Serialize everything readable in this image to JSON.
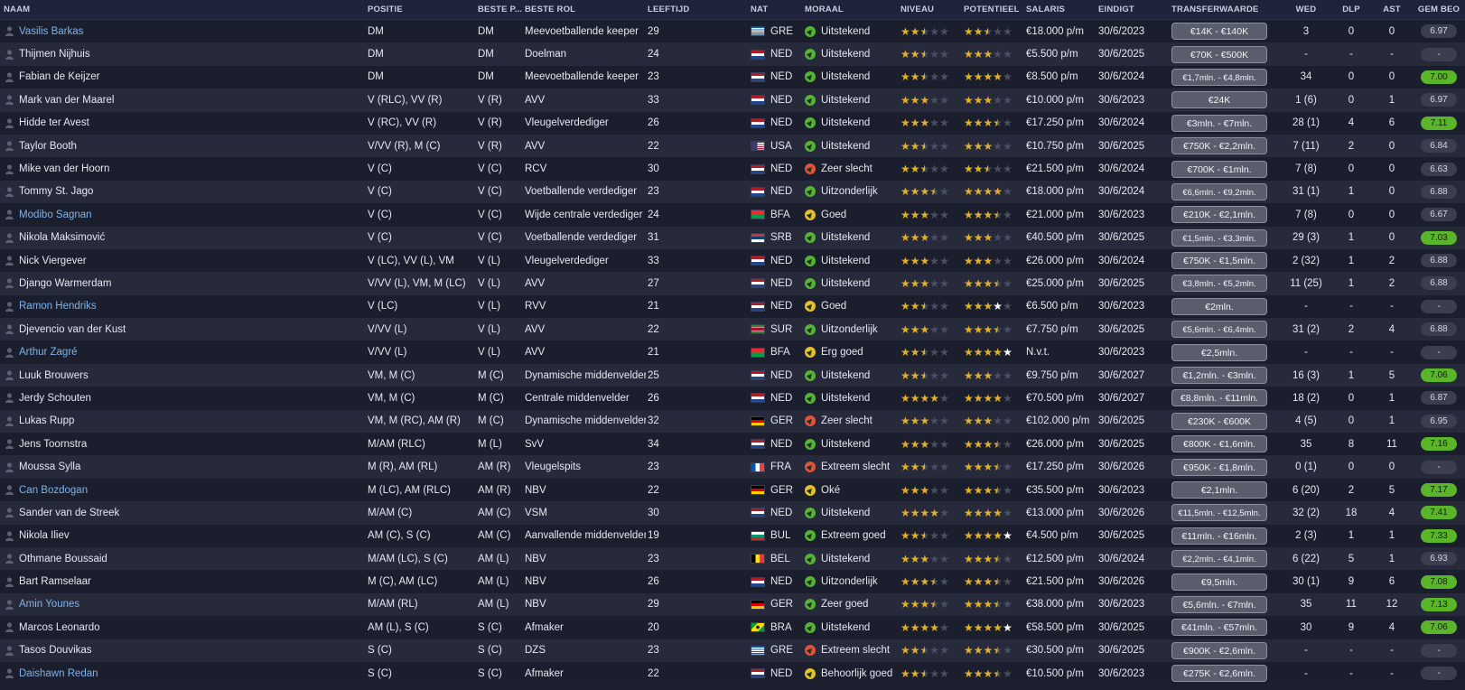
{
  "headers": {
    "name": "NAAM",
    "pos": "POSITIE",
    "best": "BESTE P...",
    "role": "BESTE ROL",
    "age": "LEEFTIJD",
    "nat": "NAT",
    "mor": "MORAAL",
    "niv": "NIVEAU",
    "pot": "POTENTIEEL",
    "sal": "SALARIS",
    "end": "EINDIGT",
    "tv": "TRANSFERWAARDE",
    "wed": "WED",
    "dlp": "DLP",
    "ast": "AST",
    "gem": "GEM BEO"
  },
  "colors": {
    "mood_green": "#57b336",
    "mood_red": "#e0533a",
    "mood_yellow": "#e3c02c",
    "link": "#7fb3ea",
    "star": "#e0b12e",
    "rating_green": "#5bb52a"
  },
  "players": [
    {
      "name": "Vasilis Barkas",
      "link": true,
      "pos": "DM",
      "best": "DM",
      "role": "Meevoetballende keeper",
      "age": "29",
      "nat": "GRE",
      "flag": "gre",
      "mood": "Uitstekend",
      "mood_type": "green",
      "niv": 2.5,
      "pot": 2.5,
      "sal": "€18.000 p/m",
      "end": "30/6/2023",
      "tv": "€14K - €140K",
      "tv_small": false,
      "wed": "3",
      "dlp": "0",
      "ast": "0",
      "gem": "6.97",
      "gem_green": false
    },
    {
      "name": "Thijmen Nijhuis",
      "link": false,
      "pos": "DM",
      "best": "DM",
      "role": "Doelman",
      "age": "24",
      "nat": "NED",
      "flag": "ned",
      "mood": "Uitstekend",
      "mood_type": "green",
      "niv": 2.5,
      "pot": 3,
      "sal": "€5.500 p/m",
      "end": "30/6/2025",
      "tv": "€70K - €500K",
      "tv_small": false,
      "wed": "-",
      "dlp": "-",
      "ast": "-",
      "gem": "-",
      "gem_green": false
    },
    {
      "name": "Fabian de Keijzer",
      "link": false,
      "pos": "DM",
      "best": "DM",
      "role": "Meevoetballende keeper",
      "age": "23",
      "nat": "NED",
      "flag": "ned",
      "mood": "Uitstekend",
      "mood_type": "green",
      "niv": 2.5,
      "pot": 4,
      "sal": "€8.500 p/m",
      "end": "30/6/2024",
      "tv": "€1,7mln. - €4,8mln.",
      "tv_small": true,
      "wed": "34",
      "dlp": "0",
      "ast": "0",
      "gem": "7.00",
      "gem_green": true
    },
    {
      "name": "Mark van der Maarel",
      "link": false,
      "pos": "V (RLC), VV (R)",
      "best": "V (R)",
      "role": "AVV",
      "age": "33",
      "nat": "NED",
      "flag": "ned",
      "mood": "Uitstekend",
      "mood_type": "green",
      "niv": 3,
      "pot": 3,
      "sal": "€10.000 p/m",
      "end": "30/6/2023",
      "tv": "€24K",
      "tv_small": false,
      "wed": "1 (6)",
      "dlp": "0",
      "ast": "1",
      "gem": "6.97",
      "gem_green": false
    },
    {
      "name": "Hidde ter Avest",
      "link": false,
      "pos": "V (RC), VV (R)",
      "best": "V (R)",
      "role": "Vleugelverdediger",
      "age": "26",
      "nat": "NED",
      "flag": "ned",
      "mood": "Uitstekend",
      "mood_type": "green",
      "niv": 3,
      "pot": 3.5,
      "sal": "€17.250 p/m",
      "end": "30/6/2024",
      "tv": "€3mln. - €7mln.",
      "tv_small": false,
      "wed": "28 (1)",
      "dlp": "4",
      "ast": "6",
      "gem": "7.11",
      "gem_green": true
    },
    {
      "name": "Taylor Booth",
      "link": false,
      "pos": "V/VV (R), M (C)",
      "best": "V (R)",
      "role": "AVV",
      "age": "22",
      "nat": "USA",
      "flag": "usa",
      "mood": "Uitstekend",
      "mood_type": "green",
      "niv": 2.5,
      "pot": 3,
      "sal": "€10.750 p/m",
      "end": "30/6/2025",
      "tv": "€750K - €2,2mln.",
      "tv_small": false,
      "wed": "7 (11)",
      "dlp": "2",
      "ast": "0",
      "gem": "6.84",
      "gem_green": false
    },
    {
      "name": "Mike van der Hoorn",
      "link": false,
      "pos": "V (C)",
      "best": "V (C)",
      "role": "RCV",
      "age": "30",
      "nat": "NED",
      "flag": "ned",
      "mood": "Zeer slecht",
      "mood_type": "red",
      "niv": 2.5,
      "pot": 2.5,
      "sal": "€21.500 p/m",
      "end": "30/6/2024",
      "tv": "€700K - €1mln.",
      "tv_small": false,
      "wed": "7 (8)",
      "dlp": "0",
      "ast": "0",
      "gem": "6.63",
      "gem_green": false
    },
    {
      "name": "Tommy St. Jago",
      "link": false,
      "pos": "V (C)",
      "best": "V (C)",
      "role": "Voetballende verdediger",
      "age": "23",
      "nat": "NED",
      "flag": "ned",
      "mood": "Uitzonderlijk",
      "mood_type": "green",
      "niv": 3.5,
      "pot": 4,
      "sal": "€18.000 p/m",
      "end": "30/6/2024",
      "tv": "€6,6mln. - €9,2mln.",
      "tv_small": true,
      "wed": "31 (1)",
      "dlp": "1",
      "ast": "0",
      "gem": "6.88",
      "gem_green": false
    },
    {
      "name": "Modibo Sagnan",
      "link": true,
      "pos": "V (C)",
      "best": "V (C)",
      "role": "Wijde centrale verdediger",
      "age": "24",
      "nat": "BFA",
      "flag": "bfa",
      "mood": "Goed",
      "mood_type": "yellow",
      "niv": 3,
      "pot": 3.5,
      "sal": "€21.000 p/m",
      "end": "30/6/2023",
      "tv": "€210K - €2,1mln.",
      "tv_small": false,
      "wed": "7 (8)",
      "dlp": "0",
      "ast": "0",
      "gem": "6.67",
      "gem_green": false
    },
    {
      "name": "Nikola Maksimović",
      "link": false,
      "pos": "V (C)",
      "best": "V (C)",
      "role": "Voetballende verdediger",
      "age": "31",
      "nat": "SRB",
      "flag": "srb",
      "mood": "Uitstekend",
      "mood_type": "green",
      "niv": 3,
      "pot": 3,
      "sal": "€40.500 p/m",
      "end": "30/6/2025",
      "tv": "€1,5mln. - €3,3mln.",
      "tv_small": true,
      "wed": "29 (3)",
      "dlp": "1",
      "ast": "0",
      "gem": "7.03",
      "gem_green": true
    },
    {
      "name": "Nick Viergever",
      "link": false,
      "pos": "V (LC), VV (L), VM",
      "best": "V (L)",
      "role": "Vleugelverdediger",
      "age": "33",
      "nat": "NED",
      "flag": "ned",
      "mood": "Uitstekend",
      "mood_type": "green",
      "niv": 3,
      "pot": 3,
      "sal": "€26.000 p/m",
      "end": "30/6/2024",
      "tv": "€750K - €1,5mln.",
      "tv_small": false,
      "wed": "2 (32)",
      "dlp": "1",
      "ast": "2",
      "gem": "6.88",
      "gem_green": false
    },
    {
      "name": "Django Warmerdam",
      "link": false,
      "pos": "V/VV (L), VM, M (LC)",
      "best": "V (L)",
      "role": "AVV",
      "age": "27",
      "nat": "NED",
      "flag": "ned",
      "mood": "Uitstekend",
      "mood_type": "green",
      "niv": 3,
      "pot": 3.5,
      "sal": "€25.000 p/m",
      "end": "30/6/2025",
      "tv": "€3,8mln. - €5,2mln.",
      "tv_small": true,
      "wed": "11 (25)",
      "dlp": "1",
      "ast": "2",
      "gem": "6.88",
      "gem_green": false
    },
    {
      "name": "Ramon Hendriks",
      "link": true,
      "pos": "V (LC)",
      "best": "V (L)",
      "role": "RVV",
      "age": "21",
      "nat": "NED",
      "flag": "ned",
      "mood": "Goed",
      "mood_type": "yellow",
      "niv": 2.5,
      "pot": 3.5,
      "pot_white": true,
      "sal": "€6.500 p/m",
      "end": "30/6/2023",
      "tv": "€2mln.",
      "tv_small": false,
      "wed": "-",
      "dlp": "-",
      "ast": "-",
      "gem": "-",
      "gem_green": false
    },
    {
      "name": "Djevencio van der Kust",
      "link": false,
      "pos": "V/VV (L)",
      "best": "V (L)",
      "role": "AVV",
      "age": "22",
      "nat": "SUR",
      "flag": "sur",
      "mood": "Uitzonderlijk",
      "mood_type": "green",
      "niv": 3,
      "pot": 3.5,
      "sal": "€7.750 p/m",
      "end": "30/6/2025",
      "tv": "€5,6mln. - €6,4mln.",
      "tv_small": true,
      "wed": "31 (2)",
      "dlp": "2",
      "ast": "4",
      "gem": "6.88",
      "gem_green": false
    },
    {
      "name": "Arthur Zagré",
      "link": true,
      "pos": "V/VV (L)",
      "best": "V (L)",
      "role": "AVV",
      "age": "21",
      "nat": "BFA",
      "flag": "bfa",
      "mood": "Erg goed",
      "mood_type": "yellow",
      "niv": 2.5,
      "pot": 4.5,
      "pot_white": true,
      "sal": "N.v.t.",
      "end": "30/6/2023",
      "tv": "€2,5mln.",
      "tv_small": false,
      "wed": "-",
      "dlp": "-",
      "ast": "-",
      "gem": "-",
      "gem_green": false
    },
    {
      "name": "Luuk Brouwers",
      "link": false,
      "pos": "VM, M (C)",
      "best": "M (C)",
      "role": "Dynamische middenvelder",
      "age": "25",
      "nat": "NED",
      "flag": "ned",
      "mood": "Uitstekend",
      "mood_type": "green",
      "niv": 2.5,
      "pot": 3,
      "sal": "€9.750 p/m",
      "end": "30/6/2027",
      "tv": "€1,2mln. - €3mln.",
      "tv_small": false,
      "wed": "16 (3)",
      "dlp": "1",
      "ast": "5",
      "gem": "7.06",
      "gem_green": true
    },
    {
      "name": "Jerdy Schouten",
      "link": false,
      "pos": "VM, M (C)",
      "best": "M (C)",
      "role": "Centrale middenvelder",
      "age": "26",
      "nat": "NED",
      "flag": "ned",
      "mood": "Uitstekend",
      "mood_type": "green",
      "niv": 4,
      "pot": 4,
      "sal": "€70.500 p/m",
      "end": "30/6/2027",
      "tv": "€8,8mln. - €11mln.",
      "tv_small": false,
      "wed": "18 (2)",
      "dlp": "0",
      "ast": "1",
      "gem": "6.87",
      "gem_green": false
    },
    {
      "name": "Lukas Rupp",
      "link": false,
      "pos": "VM, M (RC), AM (R)",
      "best": "M (C)",
      "role": "Dynamische middenvelder",
      "age": "32",
      "nat": "GER",
      "flag": "ger",
      "mood": "Zeer slecht",
      "mood_type": "red",
      "niv": 3,
      "pot": 3,
      "sal": "€102.000 p/m",
      "end": "30/6/2025",
      "tv": "€230K - €600K",
      "tv_small": false,
      "wed": "4 (5)",
      "dlp": "0",
      "ast": "1",
      "gem": "6.95",
      "gem_green": false
    },
    {
      "name": "Jens Toornstra",
      "link": false,
      "pos": "M/AM (RLC)",
      "best": "M (L)",
      "role": "SvV",
      "age": "34",
      "nat": "NED",
      "flag": "ned",
      "mood": "Uitstekend",
      "mood_type": "green",
      "niv": 3,
      "pot": 3.5,
      "sal": "€26.000 p/m",
      "end": "30/6/2025",
      "tv": "€800K - €1,6mln.",
      "tv_small": false,
      "wed": "35",
      "dlp": "8",
      "ast": "11",
      "gem": "7.16",
      "gem_green": true
    },
    {
      "name": "Moussa Sylla",
      "link": false,
      "pos": "M (R), AM (RL)",
      "best": "AM (R)",
      "role": "Vleugelspits",
      "age": "23",
      "nat": "FRA",
      "flag": "fra",
      "mood": "Extreem slecht",
      "mood_type": "red",
      "niv": 2.5,
      "pot": 3.5,
      "sal": "€17.250 p/m",
      "end": "30/6/2026",
      "tv": "€950K - €1,8mln.",
      "tv_small": false,
      "wed": "0 (1)",
      "dlp": "0",
      "ast": "0",
      "gem": "-",
      "gem_green": false
    },
    {
      "name": "Can Bozdogan",
      "link": true,
      "pos": "M (LC), AM (RLC)",
      "best": "AM (R)",
      "role": "NBV",
      "age": "22",
      "nat": "GER",
      "flag": "ger",
      "mood": "Oké",
      "mood_type": "yellow",
      "niv": 3,
      "pot": 3.5,
      "sal": "€35.500 p/m",
      "end": "30/6/2023",
      "tv": "€2,1mln.",
      "tv_small": false,
      "wed": "6 (20)",
      "dlp": "2",
      "ast": "5",
      "gem": "7.17",
      "gem_green": true
    },
    {
      "name": "Sander van de Streek",
      "link": false,
      "pos": "M/AM (C)",
      "best": "AM (C)",
      "role": "VSM",
      "age": "30",
      "nat": "NED",
      "flag": "ned",
      "mood": "Uitstekend",
      "mood_type": "green",
      "niv": 4,
      "pot": 4,
      "sal": "€13.000 p/m",
      "end": "30/6/2026",
      "tv": "€11,5mln. - €12,5mln.",
      "tv_small": true,
      "wed": "32 (2)",
      "dlp": "18",
      "ast": "4",
      "gem": "7.41",
      "gem_green": true
    },
    {
      "name": "Nikola Iliev",
      "link": false,
      "pos": "AM (C), S (C)",
      "best": "AM (C)",
      "role": "Aanvallende middenvelder",
      "age": "19",
      "nat": "BUL",
      "flag": "bul",
      "mood": "Extreem goed",
      "mood_type": "green",
      "niv": 2.5,
      "pot": 5,
      "pot_white": true,
      "sal": "€4.500 p/m",
      "end": "30/6/2025",
      "tv": "€11mln. - €16mln.",
      "tv_small": false,
      "wed": "2 (3)",
      "dlp": "1",
      "ast": "1",
      "gem": "7.33",
      "gem_green": true
    },
    {
      "name": "Othmane Boussaid",
      "link": false,
      "pos": "M/AM (LC), S (C)",
      "best": "AM (L)",
      "role": "NBV",
      "age": "23",
      "nat": "BEL",
      "flag": "bel",
      "mood": "Uitstekend",
      "mood_type": "green",
      "niv": 3,
      "pot": 3.5,
      "sal": "€12.500 p/m",
      "end": "30/6/2024",
      "tv": "€2,2mln. - €4,1mln.",
      "tv_small": true,
      "wed": "6 (22)",
      "dlp": "5",
      "ast": "1",
      "gem": "6.93",
      "gem_green": false
    },
    {
      "name": "Bart Ramselaar",
      "link": false,
      "pos": "M (C), AM (LC)",
      "best": "AM (L)",
      "role": "NBV",
      "age": "26",
      "nat": "NED",
      "flag": "ned",
      "mood": "Uitzonderlijk",
      "mood_type": "green",
      "niv": 3.5,
      "pot": 3.5,
      "sal": "€21.500 p/m",
      "end": "30/6/2026",
      "tv": "€9,5mln.",
      "tv_small": false,
      "wed": "30 (1)",
      "dlp": "9",
      "ast": "6",
      "gem": "7.08",
      "gem_green": true
    },
    {
      "name": "Amin Younes",
      "link": true,
      "pos": "M/AM (RL)",
      "best": "AM (L)",
      "role": "NBV",
      "age": "29",
      "nat": "GER",
      "flag": "ger",
      "mood": "Zeer goed",
      "mood_type": "green",
      "niv": 3.5,
      "pot": 3.5,
      "sal": "€38.000 p/m",
      "end": "30/6/2023",
      "tv": "€5,6mln. - €7mln.",
      "tv_small": false,
      "wed": "35",
      "dlp": "11",
      "ast": "12",
      "gem": "7.13",
      "gem_green": true
    },
    {
      "name": "Marcos Leonardo",
      "link": false,
      "pos": "AM (L), S (C)",
      "best": "S (C)",
      "role": "Afmaker",
      "age": "20",
      "nat": "BRA",
      "flag": "bra",
      "mood": "Uitstekend",
      "mood_type": "green",
      "niv": 4,
      "pot": 5,
      "pot_white": true,
      "sal": "€58.500 p/m",
      "end": "30/6/2025",
      "tv": "€41mln. - €57mln.",
      "tv_small": false,
      "wed": "30",
      "dlp": "9",
      "ast": "4",
      "gem": "7.06",
      "gem_green": true
    },
    {
      "name": "Tasos Douvikas",
      "link": false,
      "pos": "S (C)",
      "best": "S (C)",
      "role": "DZS",
      "age": "23",
      "nat": "GRE",
      "flag": "gre",
      "mood": "Extreem slecht",
      "mood_type": "red",
      "niv": 2.5,
      "pot": 3.5,
      "sal": "€30.500 p/m",
      "end": "30/6/2025",
      "tv": "€900K - €2,6mln.",
      "tv_small": false,
      "wed": "-",
      "dlp": "-",
      "ast": "-",
      "gem": "-",
      "gem_green": false
    },
    {
      "name": "Daishawn Redan",
      "link": true,
      "pos": "S (C)",
      "best": "S (C)",
      "role": "Afmaker",
      "age": "22",
      "nat": "NED",
      "flag": "ned",
      "mood": "Behoorlijk goed",
      "mood_type": "yellow",
      "niv": 2.5,
      "pot": 3.5,
      "sal": "€10.500 p/m",
      "end": "30/6/2023",
      "tv": "€275K - €2,6mln.",
      "tv_small": false,
      "wed": "-",
      "dlp": "-",
      "ast": "-",
      "gem": "-",
      "gem_green": false
    }
  ]
}
